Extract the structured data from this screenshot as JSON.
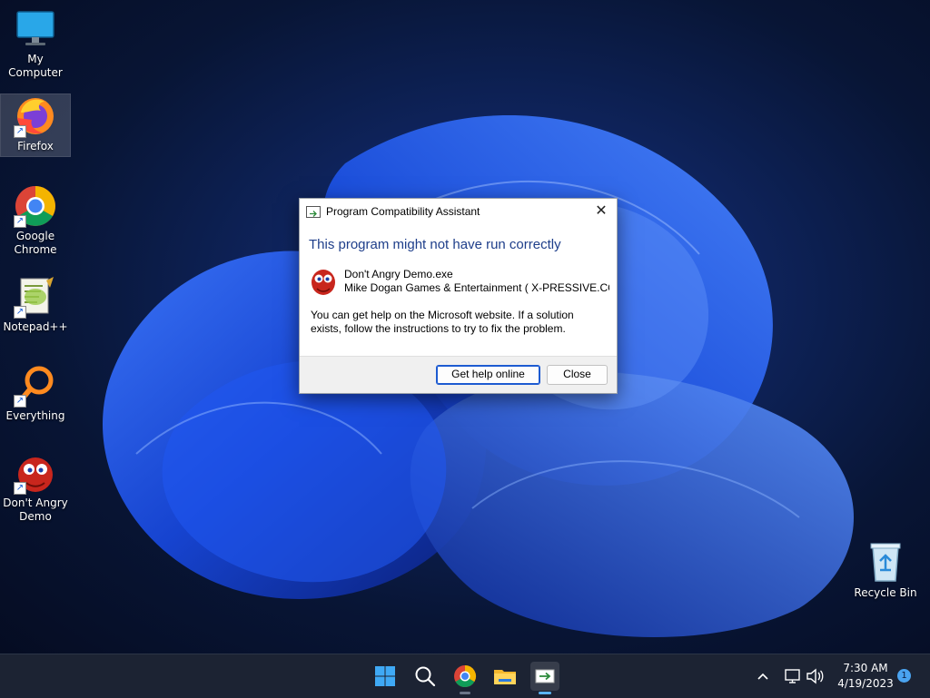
{
  "desktop": {
    "icons": [
      {
        "label": "My Computer",
        "icon": "monitor-icon"
      },
      {
        "label": "Firefox",
        "icon": "firefox-icon"
      },
      {
        "label": "Google Chrome",
        "icon": "chrome-icon"
      },
      {
        "label": "Notepad++",
        "icon": "notepadpp-icon"
      },
      {
        "label": "Everything",
        "icon": "magnifier-ring-icon"
      },
      {
        "label": "Don't Angry Demo",
        "icon": "red-creature-icon"
      },
      {
        "label": "Recycle Bin",
        "icon": "recycle-bin-icon"
      }
    ]
  },
  "dialog": {
    "title": "Program Compatibility Assistant",
    "close_glyph": "✕",
    "heading": "This program might not have run correctly",
    "app_name": "Don't Angry Demo.exe",
    "publisher": "Mike Dogan Games & Entertainment ( X-PRESSIVE.COM",
    "message": "You can get help on the Microsoft website.  If a solution exists, follow the instructions to try to fix the problem.",
    "buttons": {
      "primary": "Get help online",
      "secondary": "Close"
    }
  },
  "taskbar": {
    "apps": [
      "windows-start-icon",
      "search-icon",
      "chrome-icon",
      "file-explorer-icon",
      "compatibility-assistant-icon"
    ],
    "clock": {
      "time": "7:30 AM",
      "date": "4/19/2023"
    },
    "notification_count": "1"
  },
  "colors": {
    "heading_blue": "#1e3e8a",
    "primary_button_border": "#1d5bd1",
    "taskbar_bg": "#1c2333"
  }
}
